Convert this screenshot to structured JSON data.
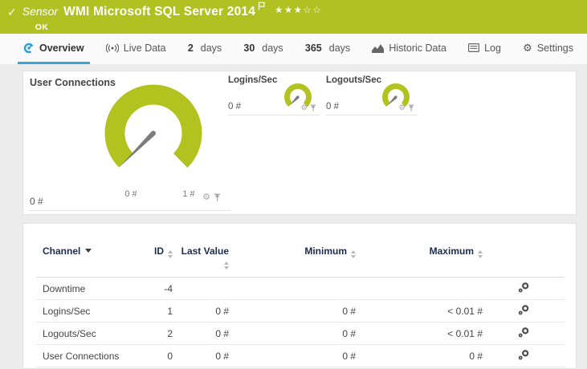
{
  "colors": {
    "green": "#b1c121",
    "gauge_green": "#b2c31f",
    "blue": "#35a8da",
    "navy": "#1b2b4f",
    "needle_gray": "#7d7d7d"
  },
  "header": {
    "kind": "Sensor",
    "title": "WMI Microsoft SQL Server 2014",
    "status": "OK",
    "stars": {
      "filled": 3,
      "total": 5,
      "display": "★★★☆☆"
    }
  },
  "icons": {
    "check": "✓",
    "gear": "⚙"
  },
  "tabs": [
    {
      "label": "Overview",
      "icon": "gauge-icon",
      "active": true
    },
    {
      "label": "Live Data",
      "icon": "broadcast-icon",
      "active": false
    },
    {
      "num": "2",
      "label": "days",
      "active": false
    },
    {
      "num": "30",
      "label": "days",
      "active": false
    },
    {
      "num": "365",
      "label": "days",
      "active": false
    },
    {
      "label": "Historic Data",
      "icon": "area-chart-icon",
      "active": false
    },
    {
      "label": "Log",
      "icon": "log-icon",
      "active": false
    },
    {
      "label": "Settings",
      "icon": "gear-icon",
      "active": false
    }
  ],
  "gauges": {
    "primary": {
      "title": "User Connections",
      "value": "0 #",
      "scale_min": "0 #",
      "scale_max": "1 #"
    },
    "secondary": [
      {
        "title": "Logins/Sec",
        "value": "0 #"
      },
      {
        "title": "Logouts/Sec",
        "value": "0 #"
      }
    ]
  },
  "table": {
    "columns": [
      "Channel",
      "ID",
      "Last Value",
      "Minimum",
      "Maximum"
    ],
    "rows": [
      {
        "channel": "Downtime",
        "id": "-4",
        "last": "",
        "min": "",
        "max": ""
      },
      {
        "channel": "Logins/Sec",
        "id": "1",
        "last": "0 #",
        "min": "0 #",
        "max": "< 0.01 #"
      },
      {
        "channel": "Logouts/Sec",
        "id": "2",
        "last": "0 #",
        "min": "0 #",
        "max": "< 0.01 #"
      },
      {
        "channel": "User Connections",
        "id": "0",
        "last": "0 #",
        "min": "0 #",
        "max": "0 #"
      }
    ]
  }
}
